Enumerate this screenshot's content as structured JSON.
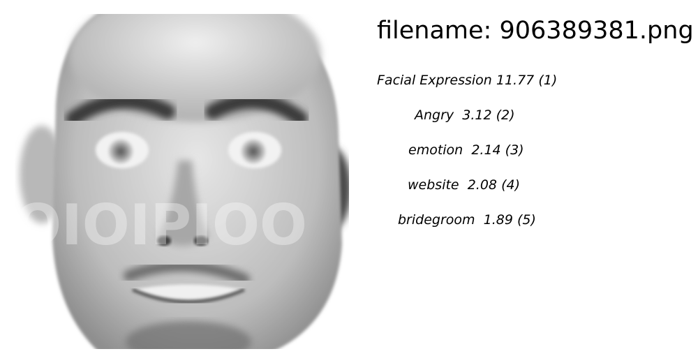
{
  "header": {
    "filename_prefix": "filename:",
    "filename_value": "906389381.png"
  },
  "image": {
    "icon": "face-photo",
    "watermark_text": "OIOIPIOO"
  },
  "tags": [
    {
      "label": "Facial Expression",
      "score": "11.77",
      "rank": "(1)"
    },
    {
      "label": "Angry",
      "score": "3.12",
      "rank": "(2)"
    },
    {
      "label": "emotion",
      "score": "2.14",
      "rank": "(3)"
    },
    {
      "label": "website",
      "score": "2.08",
      "rank": "(4)"
    },
    {
      "label": "bridegroom",
      "score": "1.89",
      "rank": "(5)"
    }
  ]
}
